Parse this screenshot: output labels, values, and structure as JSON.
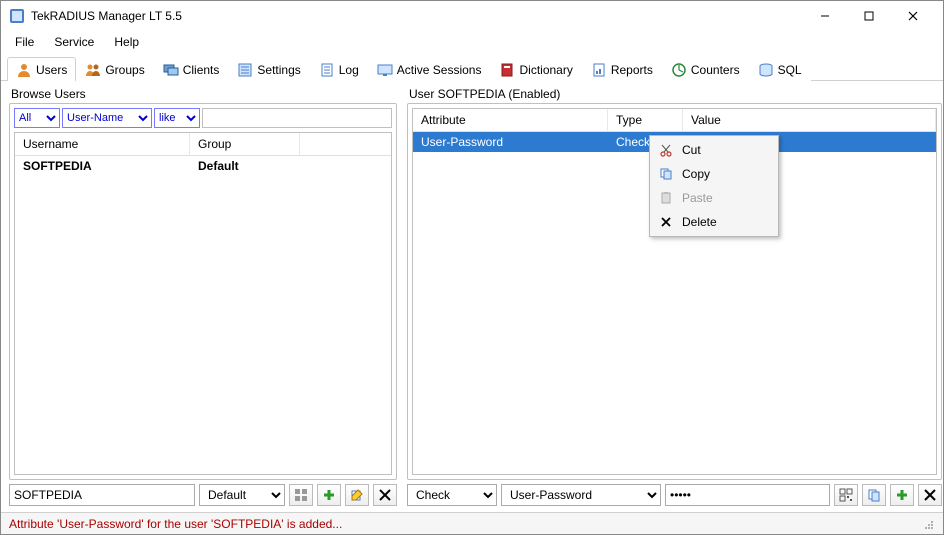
{
  "window": {
    "title": "TekRADIUS Manager LT 5.5"
  },
  "menubar": {
    "items": [
      "File",
      "Service",
      "Help"
    ]
  },
  "tabs": [
    {
      "label": "Users",
      "icon": "user"
    },
    {
      "label": "Groups",
      "icon": "group"
    },
    {
      "label": "Clients",
      "icon": "client"
    },
    {
      "label": "Settings",
      "icon": "settings"
    },
    {
      "label": "Log",
      "icon": "log"
    },
    {
      "label": "Active Sessions",
      "icon": "sessions"
    },
    {
      "label": "Dictionary",
      "icon": "dictionary"
    },
    {
      "label": "Reports",
      "icon": "reports"
    },
    {
      "label": "Counters",
      "icon": "counters"
    },
    {
      "label": "SQL",
      "icon": "sql"
    }
  ],
  "active_tab": "Users",
  "left_panel": {
    "title": "Browse Users",
    "filters": {
      "scope": "All",
      "field": "User-Name",
      "op": "like",
      "value": ""
    },
    "columns": [
      "Username",
      "Group"
    ],
    "rows": [
      {
        "username": "SOFTPEDIA",
        "group": "Default"
      }
    ],
    "bottom": {
      "username_input": "SOFTPEDIA",
      "group_select": "Default"
    }
  },
  "right_panel": {
    "title": "User SOFTPEDIA (Enabled)",
    "columns": [
      "Attribute",
      "Type",
      "Value"
    ],
    "rows": [
      {
        "attribute": "User-Password",
        "type": "Check",
        "value": "******"
      }
    ],
    "bottom": {
      "type_select": "Check",
      "attr_select": "User-Password",
      "value_input": "•••••"
    }
  },
  "context_menu": {
    "items": [
      {
        "label": "Cut",
        "icon": "cut",
        "enabled": true
      },
      {
        "label": "Copy",
        "icon": "copy",
        "enabled": true
      },
      {
        "label": "Paste",
        "icon": "paste",
        "enabled": false
      },
      {
        "label": "Delete",
        "icon": "delete",
        "enabled": true
      }
    ]
  },
  "statusbar": {
    "message": "Attribute 'User-Password' for the user 'SOFTPEDIA' is added..."
  }
}
